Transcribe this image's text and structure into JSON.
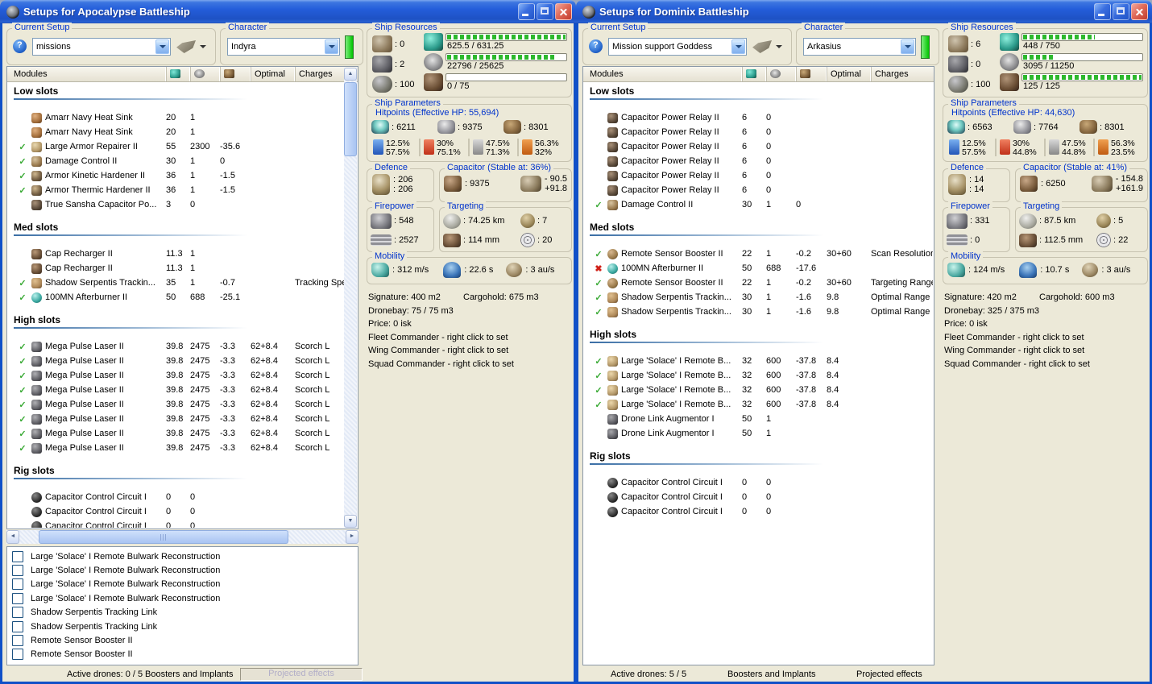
{
  "windows": [
    {
      "title": "Setups for Apocalypse Battleship",
      "setup_group": {
        "label": "Current Setup",
        "value": "missions"
      },
      "character_group": {
        "label": "Character",
        "value": "Indyra"
      },
      "columns": {
        "modules": "Modules",
        "optimal": "Optimal",
        "charges": "Charges"
      },
      "sections": [
        {
          "name": "Low slots",
          "rows": [
            {
              "status": "",
              "icon": "heat-sink",
              "name": "Amarr Navy Heat Sink",
              "cpu": "20",
              "pg": "1",
              "cap": "",
              "optimal": "",
              "charge": ""
            },
            {
              "status": "",
              "icon": "heat-sink",
              "name": "Amarr Navy Heat Sink",
              "cpu": "20",
              "pg": "1",
              "cap": "",
              "optimal": "",
              "charge": ""
            },
            {
              "status": "on",
              "icon": "armor-repairer",
              "name": "Large Armor Repairer II",
              "cpu": "55",
              "pg": "2300",
              "cap": "-35.6",
              "optimal": "",
              "charge": ""
            },
            {
              "status": "on",
              "icon": "damage-control",
              "name": "Damage Control II",
              "cpu": "30",
              "pg": "1",
              "cap": "0",
              "optimal": "",
              "charge": ""
            },
            {
              "status": "on",
              "icon": "armor-hardener",
              "name": "Armor Kinetic Hardener II",
              "cpu": "36",
              "pg": "1",
              "cap": "-1.5",
              "optimal": "",
              "charge": ""
            },
            {
              "status": "on",
              "icon": "armor-hardener",
              "name": "Armor Thermic Hardener II",
              "cpu": "36",
              "pg": "1",
              "cap": "-1.5",
              "optimal": "",
              "charge": ""
            },
            {
              "status": "",
              "icon": "cap-battery",
              "name": "True Sansha Capacitor Po...",
              "cpu": "3",
              "pg": "0",
              "cap": "",
              "optimal": "",
              "charge": ""
            }
          ]
        },
        {
          "name": "Med slots",
          "rows": [
            {
              "status": "",
              "icon": "cap-recharger",
              "name": "Cap Recharger II",
              "cpu": "11.3",
              "pg": "1",
              "cap": "",
              "optimal": "",
              "charge": ""
            },
            {
              "status": "",
              "icon": "cap-recharger",
              "name": "Cap Recharger II",
              "cpu": "11.3",
              "pg": "1",
              "cap": "",
              "optimal": "",
              "charge": ""
            },
            {
              "status": "on",
              "icon": "tracking-link",
              "name": "Shadow Serpentis Trackin...",
              "cpu": "35",
              "pg": "1",
              "cap": "-0.7",
              "optimal": "",
              "charge": "Tracking Speed"
            },
            {
              "status": "on",
              "icon": "afterburner",
              "name": "100MN Afterburner II",
              "cpu": "50",
              "pg": "688",
              "cap": "-25.1",
              "optimal": "",
              "charge": ""
            }
          ]
        },
        {
          "name": "High slots",
          "rows": [
            {
              "status": "on",
              "icon": "pulse-laser",
              "name": "Mega Pulse Laser II",
              "cpu": "39.8",
              "pg": "2475",
              "cap": "-3.3",
              "optimal": "62+8.4",
              "charge": "Scorch L"
            },
            {
              "status": "on",
              "icon": "pulse-laser",
              "name": "Mega Pulse Laser II",
              "cpu": "39.8",
              "pg": "2475",
              "cap": "-3.3",
              "optimal": "62+8.4",
              "charge": "Scorch L"
            },
            {
              "status": "on",
              "icon": "pulse-laser",
              "name": "Mega Pulse Laser II",
              "cpu": "39.8",
              "pg": "2475",
              "cap": "-3.3",
              "optimal": "62+8.4",
              "charge": "Scorch L"
            },
            {
              "status": "on",
              "icon": "pulse-laser",
              "name": "Mega Pulse Laser II",
              "cpu": "39.8",
              "pg": "2475",
              "cap": "-3.3",
              "optimal": "62+8.4",
              "charge": "Scorch L"
            },
            {
              "status": "on",
              "icon": "pulse-laser",
              "name": "Mega Pulse Laser II",
              "cpu": "39.8",
              "pg": "2475",
              "cap": "-3.3",
              "optimal": "62+8.4",
              "charge": "Scorch L"
            },
            {
              "status": "on",
              "icon": "pulse-laser",
              "name": "Mega Pulse Laser II",
              "cpu": "39.8",
              "pg": "2475",
              "cap": "-3.3",
              "optimal": "62+8.4",
              "charge": "Scorch L"
            },
            {
              "status": "on",
              "icon": "pulse-laser",
              "name": "Mega Pulse Laser II",
              "cpu": "39.8",
              "pg": "2475",
              "cap": "-3.3",
              "optimal": "62+8.4",
              "charge": "Scorch L"
            },
            {
              "status": "on",
              "icon": "pulse-laser",
              "name": "Mega Pulse Laser II",
              "cpu": "39.8",
              "pg": "2475",
              "cap": "-3.3",
              "optimal": "62+8.4",
              "charge": "Scorch L"
            }
          ]
        },
        {
          "name": "Rig slots",
          "rows": [
            {
              "status": "",
              "icon": "rig-circuit",
              "name": "Capacitor Control Circuit I",
              "cpu": "0",
              "pg": "0",
              "cap": "",
              "optimal": "",
              "charge": ""
            },
            {
              "status": "",
              "icon": "rig-circuit",
              "name": "Capacitor Control Circuit I",
              "cpu": "0",
              "pg": "0",
              "cap": "",
              "optimal": "",
              "charge": ""
            },
            {
              "status": "",
              "icon": "rig-circuit",
              "name": "Capacitor Control Circuit I",
              "cpu": "0",
              "pg": "0",
              "cap": "",
              "optimal": "",
              "charge": ""
            }
          ]
        }
      ],
      "projected_list": [
        "Large 'Solace' I Remote Bulwark Reconstruction",
        "Large 'Solace' I Remote Bulwark Reconstruction",
        "Large 'Solace' I Remote Bulwark Reconstruction",
        "Large 'Solace' I Remote Bulwark Reconstruction",
        "Shadow Serpentis Tracking Link",
        "Shadow Serpentis Tracking Link",
        "Remote Sensor Booster II",
        "Remote Sensor Booster II"
      ],
      "resources": {
        "label": "Ship Resources",
        "turrets": ": 0",
        "launchers": ": 2",
        "calibration": ": 100",
        "bars": [
          {
            "text": "625.5 / 631.25",
            "pct": 99
          },
          {
            "text": "22796 / 25625",
            "pct": 89
          },
          {
            "text": "0 / 75",
            "pct": 0
          }
        ]
      },
      "parameters": {
        "label": "Ship Parameters",
        "hitpoints_title": "Hitpoints (Effective HP: 55,694)",
        "shield": ": 6211",
        "armor": ": 9375",
        "structure": ": 8301",
        "resists": [
          {
            "a": "12.5%",
            "b": "57.5%"
          },
          {
            "a": "30%",
            "b": "75.1%"
          },
          {
            "a": "47.5%",
            "b": "71.3%"
          },
          {
            "a": "56.3%",
            "b": "32%"
          }
        ]
      },
      "defence": {
        "label": "Defence",
        "a": ": 206",
        "b": ": 206"
      },
      "capacitor": {
        "label": "Capacitor (Stable at: 36%)",
        "amount": ": 9375",
        "out": "- 90.5",
        "in": "+91.8"
      },
      "firepower": {
        "label": "Firepower",
        "dps": ": 548",
        "volley": ": 2527"
      },
      "targeting": {
        "label": "Targeting",
        "range": ": 74.25 km",
        "max_targets": ": 7",
        "scan_res": ": 114 mm",
        "sensor": ": 20"
      },
      "mobility": {
        "label": "Mobility",
        "speed": ": 312 m/s",
        "align": ": 22.6 s",
        "warp": ": 3 au/s"
      },
      "info": {
        "signature": "Signature: 400 m2",
        "cargohold": "Cargohold: 675 m3",
        "dronebay": "Dronebay: 75 / 75 m3",
        "price": "Price: 0 isk",
        "fleet": "Fleet Commander - right click to set",
        "wing": "Wing Commander - right click to set",
        "squad": "Squad Commander - right click to set"
      },
      "statusbar": {
        "active_drones": "Active drones: 0 / 5",
        "boosters": "Boosters and Implants",
        "projected": "Projected effects",
        "projected_pressed": true
      }
    },
    {
      "title": "Setups for Dominix Battleship",
      "setup_group": {
        "label": "Current Setup",
        "value": "Mission support Goddess"
      },
      "character_group": {
        "label": "Character",
        "value": "Arkasius"
      },
      "columns": {
        "modules": "Modules",
        "optimal": "Optimal",
        "charges": "Charges"
      },
      "sections": [
        {
          "name": "Low slots",
          "rows": [
            {
              "status": "",
              "icon": "cap-relay",
              "name": "Capacitor Power Relay II",
              "cpu": "6",
              "pg": "0",
              "cap": "",
              "optimal": "",
              "charge": ""
            },
            {
              "status": "",
              "icon": "cap-relay",
              "name": "Capacitor Power Relay II",
              "cpu": "6",
              "pg": "0",
              "cap": "",
              "optimal": "",
              "charge": ""
            },
            {
              "status": "",
              "icon": "cap-relay",
              "name": "Capacitor Power Relay II",
              "cpu": "6",
              "pg": "0",
              "cap": "",
              "optimal": "",
              "charge": ""
            },
            {
              "status": "",
              "icon": "cap-relay",
              "name": "Capacitor Power Relay II",
              "cpu": "6",
              "pg": "0",
              "cap": "",
              "optimal": "",
              "charge": ""
            },
            {
              "status": "",
              "icon": "cap-relay",
              "name": "Capacitor Power Relay II",
              "cpu": "6",
              "pg": "0",
              "cap": "",
              "optimal": "",
              "charge": ""
            },
            {
              "status": "",
              "icon": "cap-relay",
              "name": "Capacitor Power Relay II",
              "cpu": "6",
              "pg": "0",
              "cap": "",
              "optimal": "",
              "charge": ""
            },
            {
              "status": "on",
              "icon": "damage-control",
              "name": "Damage Control II",
              "cpu": "30",
              "pg": "1",
              "cap": "0",
              "optimal": "",
              "charge": ""
            }
          ]
        },
        {
          "name": "Med slots",
          "rows": [
            {
              "status": "on",
              "icon": "sensor-booster",
              "name": "Remote Sensor Booster II",
              "cpu": "22",
              "pg": "1",
              "cap": "-0.2",
              "optimal": "30+60",
              "charge": "Scan Resolution"
            },
            {
              "status": "off",
              "icon": "afterburner",
              "name": "100MN Afterburner II",
              "cpu": "50",
              "pg": "688",
              "cap": "-17.6",
              "optimal": "",
              "charge": ""
            },
            {
              "status": "on",
              "icon": "sensor-booster",
              "name": "Remote Sensor Booster II",
              "cpu": "22",
              "pg": "1",
              "cap": "-0.2",
              "optimal": "30+60",
              "charge": "Targeting Range"
            },
            {
              "status": "on",
              "icon": "tracking-link",
              "name": "Shadow Serpentis Trackin...",
              "cpu": "30",
              "pg": "1",
              "cap": "-1.6",
              "optimal": "9.8",
              "charge": "Optimal Range"
            },
            {
              "status": "on",
              "icon": "tracking-link",
              "name": "Shadow Serpentis Trackin...",
              "cpu": "30",
              "pg": "1",
              "cap": "-1.6",
              "optimal": "9.8",
              "charge": "Optimal Range"
            }
          ]
        },
        {
          "name": "High slots",
          "rows": [
            {
              "status": "on",
              "icon": "remote-repair",
              "name": "Large 'Solace' I Remote B...",
              "cpu": "32",
              "pg": "600",
              "cap": "-37.8",
              "optimal": "8.4",
              "charge": ""
            },
            {
              "status": "on",
              "icon": "remote-repair",
              "name": "Large 'Solace' I Remote B...",
              "cpu": "32",
              "pg": "600",
              "cap": "-37.8",
              "optimal": "8.4",
              "charge": ""
            },
            {
              "status": "on",
              "icon": "remote-repair",
              "name": "Large 'Solace' I Remote B...",
              "cpu": "32",
              "pg": "600",
              "cap": "-37.8",
              "optimal": "8.4",
              "charge": ""
            },
            {
              "status": "on",
              "icon": "remote-repair",
              "name": "Large 'Solace' I Remote B...",
              "cpu": "32",
              "pg": "600",
              "cap": "-37.8",
              "optimal": "8.4",
              "charge": ""
            },
            {
              "status": "",
              "icon": "drone-link",
              "name": "Drone Link Augmentor I",
              "cpu": "50",
              "pg": "1",
              "cap": "",
              "optimal": "",
              "charge": ""
            },
            {
              "status": "",
              "icon": "drone-link",
              "name": "Drone Link Augmentor I",
              "cpu": "50",
              "pg": "1",
              "cap": "",
              "optimal": "",
              "charge": ""
            }
          ]
        },
        {
          "name": "Rig slots",
          "rows": [
            {
              "status": "",
              "icon": "rig-circuit",
              "name": "Capacitor Control Circuit I",
              "cpu": "0",
              "pg": "0",
              "cap": "",
              "optimal": "",
              "charge": ""
            },
            {
              "status": "",
              "icon": "rig-circuit",
              "name": "Capacitor Control Circuit I",
              "cpu": "0",
              "pg": "0",
              "cap": "",
              "optimal": "",
              "charge": ""
            },
            {
              "status": "",
              "icon": "rig-circuit",
              "name": "Capacitor Control Circuit I",
              "cpu": "0",
              "pg": "0",
              "cap": "",
              "optimal": "",
              "charge": ""
            }
          ]
        }
      ],
      "resources": {
        "label": "Ship Resources",
        "turrets": ": 6",
        "launchers": ": 0",
        "calibration": ": 100",
        "bars": [
          {
            "text": "448 / 750",
            "pct": 60
          },
          {
            "text": "3095 / 11250",
            "pct": 27
          },
          {
            "text": "125 / 125",
            "pct": 100
          }
        ]
      },
      "parameters": {
        "label": "Ship Parameters",
        "hitpoints_title": "Hitpoints (Effective HP: 44,630)",
        "shield": ": 6563",
        "armor": ": 7764",
        "structure": ": 8301",
        "resists": [
          {
            "a": "12.5%",
            "b": "57.5%"
          },
          {
            "a": "30%",
            "b": "44.8%"
          },
          {
            "a": "47.5%",
            "b": "44.8%"
          },
          {
            "a": "56.3%",
            "b": "23.5%"
          }
        ]
      },
      "defence": {
        "label": "Defence",
        "a": ": 14",
        "b": ": 14"
      },
      "capacitor": {
        "label": "Capacitor (Stable at: 41%)",
        "amount": ": 6250",
        "out": "- 154.8",
        "in": "+161.9"
      },
      "firepower": {
        "label": "Firepower",
        "dps": ": 331",
        "volley": ": 0"
      },
      "targeting": {
        "label": "Targeting",
        "range": ": 87.5 km",
        "max_targets": ": 5",
        "scan_res": ": 112.5 mm",
        "sensor": ": 22"
      },
      "mobility": {
        "label": "Mobility",
        "speed": ": 124 m/s",
        "align": ": 10.7 s",
        "warp": ": 3 au/s"
      },
      "info": {
        "signature": "Signature: 420 m2",
        "cargohold": "Cargohold: 600 m3",
        "dronebay": "Dronebay: 325 / 375 m3",
        "price": "Price: 0 isk",
        "fleet": "Fleet Commander - right click to set",
        "wing": "Wing Commander - right click to set",
        "squad": "Squad Commander - right click to set"
      },
      "statusbar": {
        "active_drones": "Active drones: 5 / 5",
        "boosters": "Boosters and Implants",
        "projected": "Projected effects",
        "projected_pressed": false
      }
    }
  ]
}
